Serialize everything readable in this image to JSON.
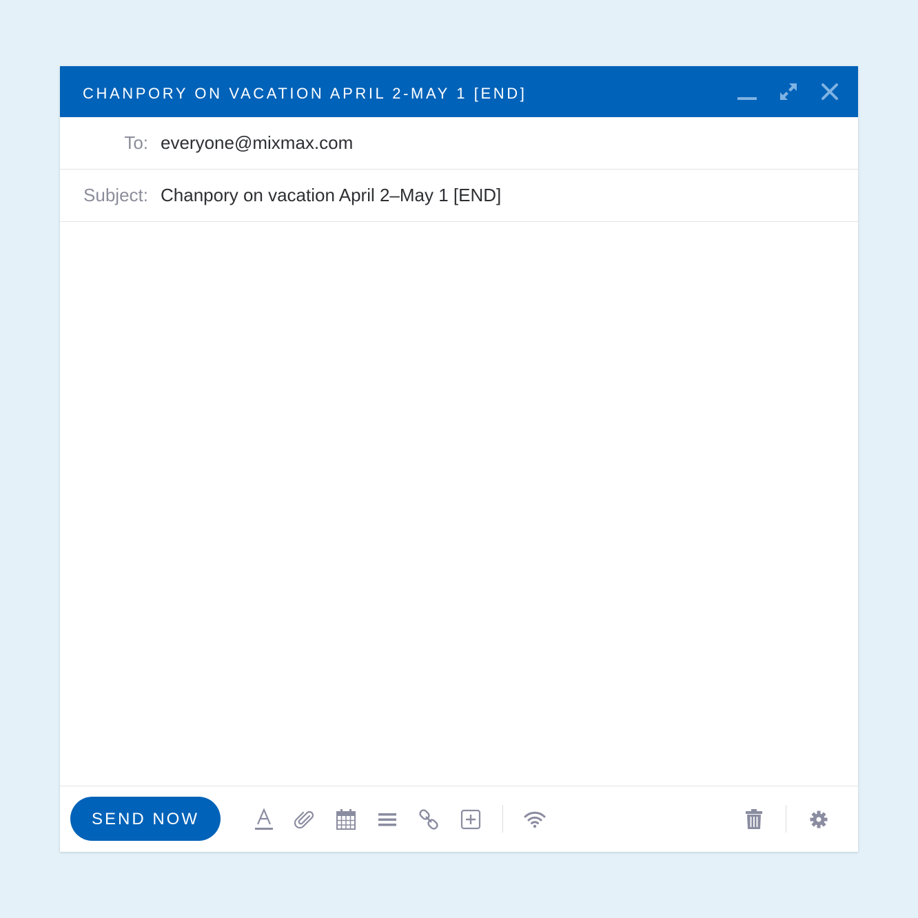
{
  "window": {
    "title": "CHANPORY ON VACATION APRIL 2-MAY 1 [END]",
    "controls": [
      "minimize-icon",
      "expand-icon",
      "close-icon"
    ]
  },
  "fields": {
    "to_label": "To:",
    "to_value": "everyone@mixmax.com",
    "subject_label": "Subject:",
    "subject_value": "Chanpory on vacation April 2–May 1 [END]"
  },
  "toolbar": {
    "send_label": "SEND NOW",
    "tools": [
      "text-format-icon",
      "attachment-icon",
      "calendar-icon",
      "list-icon",
      "link-icon",
      "add-enhancement-icon",
      "tracking-wifi-icon",
      "trash-icon",
      "settings-gear-icon"
    ]
  },
  "colors": {
    "brand_blue": "#0062b8",
    "background": "#e4f1f8",
    "icon_gray": "#8a8ca0"
  }
}
